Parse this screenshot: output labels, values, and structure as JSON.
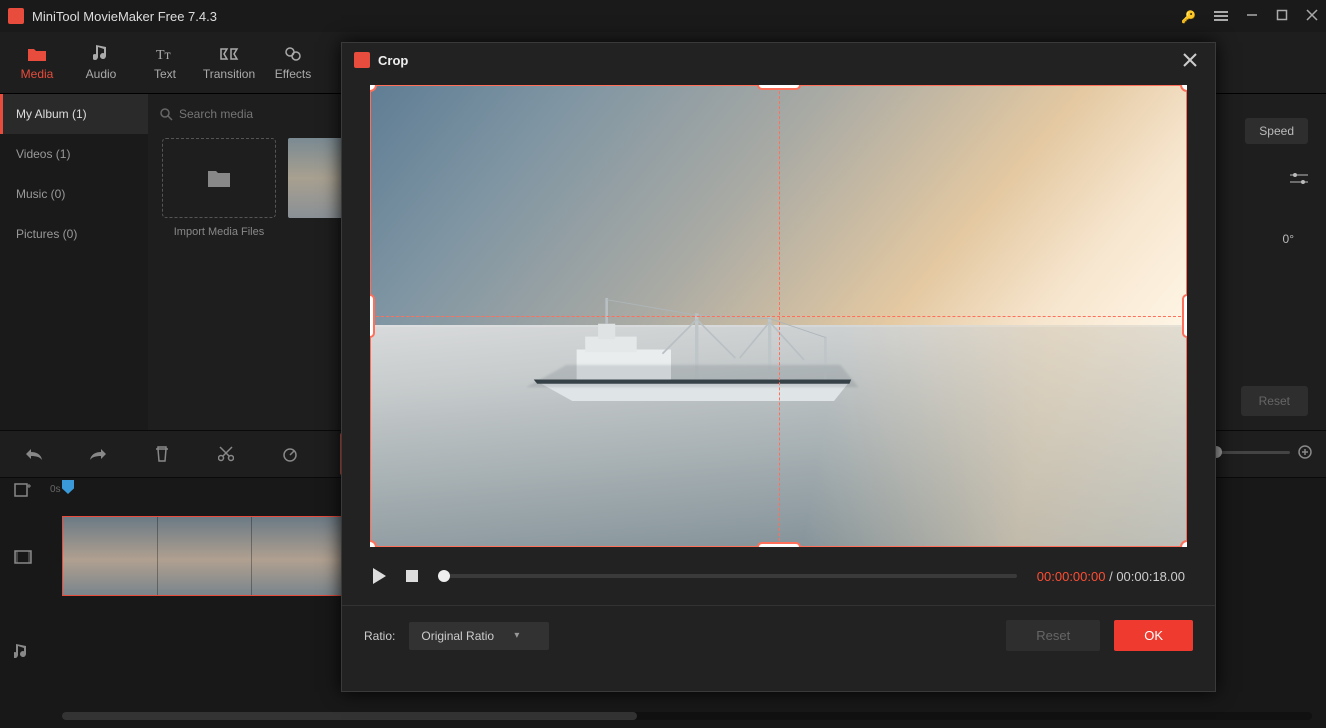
{
  "app": {
    "title": "MiniTool MovieMaker Free 7.4.3"
  },
  "main_tabs": {
    "media": "Media",
    "audio": "Audio",
    "text": "Text",
    "transition": "Transition",
    "effects": "Effects"
  },
  "sidebar": {
    "my_album": "My Album (1)",
    "videos": "Videos (1)",
    "music": "Music (0)",
    "pictures": "Pictures (0)"
  },
  "mediapane": {
    "search_placeholder": "Search media",
    "import_label": "Import Media Files"
  },
  "right_panel": {
    "speed": "Speed",
    "degree": "0°",
    "reset": "Reset"
  },
  "timeline": {
    "ruler_start": "0s"
  },
  "crop_modal": {
    "title": "Crop",
    "time_current": "00:00:00:00",
    "time_sep": " / ",
    "time_total": "00:00:18.00",
    "ratio_label": "Ratio:",
    "ratio_value": "Original Ratio",
    "reset": "Reset",
    "ok": "OK"
  }
}
